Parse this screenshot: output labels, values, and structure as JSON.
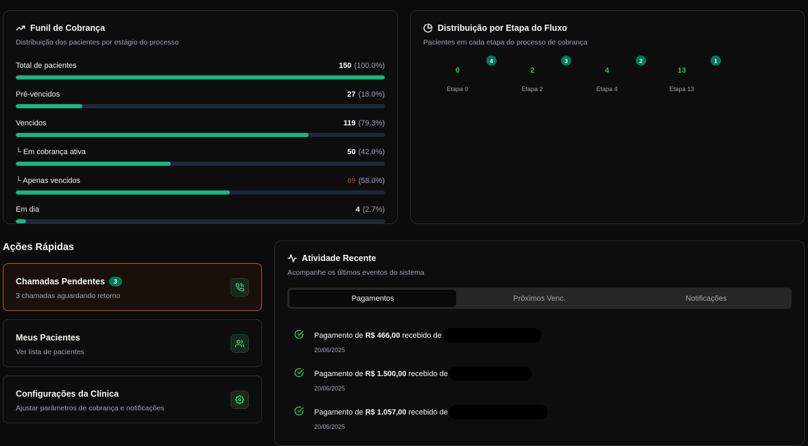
{
  "funnel": {
    "title": "Funil de Cobrança",
    "subtitle": "Distribuição dos pacientes por estágio do processo",
    "rows": [
      {
        "label": "Total de pacientes",
        "value": "150",
        "pct": "(100.0%)",
        "fraction": 1.0
      },
      {
        "label": "Pré-vencidos",
        "value": "27",
        "pct": "(18.0%)",
        "fraction": 0.18
      },
      {
        "label": "Vencidos",
        "value": "119",
        "pct": "(79.3%)",
        "fraction": 0.793
      },
      {
        "label": "└ Em cobrança ativa",
        "value": "50",
        "pct": "(42.0%)",
        "fraction": 0.42
      },
      {
        "label": "└ Apenas vencidos",
        "value": "69",
        "pct": "(58.0%)",
        "fraction": 0.58
      },
      {
        "label": "Em dia",
        "value": "4",
        "pct": "(2.7%)",
        "fraction": 0.027
      }
    ]
  },
  "distribution": {
    "title": "Distribuição por Etapa do Fluxo",
    "subtitle": "Pacientes em cada etapa do processo de cobrança",
    "stages": [
      {
        "num": "0",
        "label": "Etapa 0",
        "badge": "4"
      },
      {
        "num": "2",
        "label": "Etapa 2",
        "badge": "3"
      },
      {
        "num": "4",
        "label": "Etapa 4",
        "badge": "2"
      },
      {
        "num": "13",
        "label": "Etapa 13",
        "badge": "1"
      }
    ]
  },
  "quick_actions": {
    "title": "Ações Rápidas",
    "items": [
      {
        "title": "Chamadas Pendentes",
        "badge": "3",
        "subtitle": "3 chamadas aguardando retorno",
        "icon": "phone-call-icon"
      },
      {
        "title": "Meus Pacientes",
        "subtitle": "Ver lista de pacientes",
        "icon": "users-icon"
      },
      {
        "title": "Configurações da Clínica",
        "subtitle": "Ajustar parâmetros de cobrança e notificações",
        "icon": "gear-icon"
      }
    ]
  },
  "activity": {
    "title": "Atividade Recente",
    "subtitle": "Acompanhe os últimos eventos do sistema",
    "tabs": [
      "Pagamentos",
      "Próximos Venc.",
      "Notificações"
    ],
    "active_tab": "Pagamentos",
    "payments": [
      {
        "prefix": "Pagamento de",
        "amount": "R$ 466,00",
        "suffix": "recebido de",
        "date": "20/06/2025"
      },
      {
        "prefix": "Pagamento de",
        "amount": "R$ 1.500,00",
        "suffix": "recebido de",
        "date": "20/06/2025"
      },
      {
        "prefix": "Pagamento de",
        "amount": "R$ 1.057,00",
        "suffix": "recebido de",
        "date": "20/06/2025"
      }
    ]
  },
  "colors": {
    "accent": "#10b981",
    "accent_dark": "#047857",
    "highlight_border": "#c2571a",
    "danger": "#b4413c"
  }
}
